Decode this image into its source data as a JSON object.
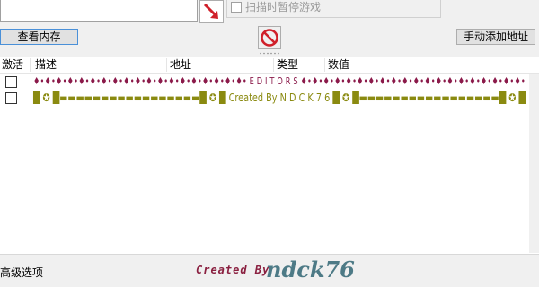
{
  "toolbar": {
    "pause_label": "扫描时暂停游戏",
    "view_memory_label": "查看内存",
    "add_address_label": "手动添加地址"
  },
  "list": {
    "columns": [
      "激活",
      "描述",
      "地址",
      "类型",
      "数值"
    ],
    "rows": [
      {
        "active": false,
        "description": "♦•♦•♦•♦•♦•♦•♦•♦•♦•♦•♦•♦•♦•♦•♦•♦•♦•♦•♦•   E D I T O R S   ♦•♦•♦•♦•♦•♦•♦•♦•♦•♦•♦•♦•♦•♦•♦•♦•♦•♦•♦•♦•"
      },
      {
        "active": false,
        "description": "█ ✪ █▬▬▬▬▬▬▬▬▬▬▬▬▬▬▬▬▬█ ✪ █    Created   By   N D C K 7 6    █ ✪ █▬▬▬▬▬▬▬▬▬▬▬▬▬▬▬▬▬█ ✪ █"
      }
    ]
  },
  "bottom": {
    "advanced_label": "高级选项",
    "credit_prefix": "Created By",
    "credit_signature": "ndck76"
  },
  "colors": {
    "editors_row": "#8b1a4a",
    "created_row": "#8a8a10",
    "signature": "#4d7a86",
    "arrow": "#d0202a",
    "nosign": "#d0202a"
  },
  "icons": {
    "arrow_button": "pointer-arrow-icon",
    "no_button": "no-entry-icon"
  }
}
